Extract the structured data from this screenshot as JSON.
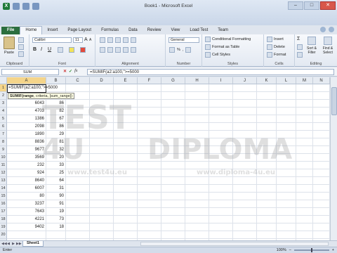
{
  "window": {
    "title": "Book1 - Microsoft Excel",
    "logo_letter": "X",
    "min_glyph": "–",
    "max_glyph": "□",
    "close_glyph": "✕"
  },
  "tabs": [
    {
      "label": "File"
    },
    {
      "label": "Home"
    },
    {
      "label": "Insert"
    },
    {
      "label": "Page Layout"
    },
    {
      "label": "Formulas"
    },
    {
      "label": "Data"
    },
    {
      "label": "Review"
    },
    {
      "label": "View"
    },
    {
      "label": "Load Test"
    },
    {
      "label": "Team"
    }
  ],
  "ribbon": {
    "clipboard": {
      "label": "Clipboard",
      "paste": "Paste"
    },
    "font": {
      "label": "Font",
      "name": "Calibri",
      "size": "11",
      "bold": "B",
      "italic": "I",
      "underline": "U",
      "grow": "A",
      "shrink": "A"
    },
    "alignment": {
      "label": "Alignment"
    },
    "number": {
      "label": "Number",
      "format": "General",
      "percent": "%",
      "comma": ","
    },
    "styles": {
      "label": "Styles",
      "conditional": "Conditional Formatting",
      "format_table": "Format as Table",
      "cell_styles": "Cell Styles"
    },
    "cells": {
      "label": "Cells",
      "insert": "Insert",
      "delete": "Delete",
      "format": "Format"
    },
    "editing": {
      "label": "Editing",
      "sort": "Sort & Filter",
      "find": "Find & Select",
      "sigma": "Σ"
    }
  },
  "formula_bar": {
    "name_box": "SUM",
    "cancel": "✕",
    "enter": "✓",
    "fx": "fx",
    "formula": "=SUMIF(a2:a100,\">=5000"
  },
  "sheet": {
    "columns": [
      "A",
      "B",
      "C",
      "D",
      "E",
      "F",
      "G",
      "H",
      "I",
      "J",
      "K",
      "L",
      "M",
      "N"
    ],
    "row_numbers": [
      "1",
      "2",
      "3",
      "4",
      "5",
      "6",
      "7",
      "8",
      "9",
      "10",
      "11",
      "12",
      "13",
      "14",
      "15",
      "16",
      "17",
      "18",
      "19",
      "20",
      "21"
    ],
    "rows": [
      {
        "a": "",
        "b": ""
      },
      {
        "a": "",
        "b": ""
      },
      {
        "a": "6043",
        "b": "86"
      },
      {
        "a": "4703",
        "b": "82"
      },
      {
        "a": "1386",
        "b": "67"
      },
      {
        "a": "2098",
        "b": "86"
      },
      {
        "a": "1890",
        "b": "29"
      },
      {
        "a": "8836",
        "b": "81"
      },
      {
        "a": "9677",
        "b": "32"
      },
      {
        "a": "3569",
        "b": "20"
      },
      {
        "a": "232",
        "b": "33"
      },
      {
        "a": "924",
        "b": "25"
      },
      {
        "a": "8640",
        "b": "64"
      },
      {
        "a": "6007",
        "b": "31"
      },
      {
        "a": "80",
        "b": "90"
      },
      {
        "a": "3237",
        "b": "91"
      },
      {
        "a": "7643",
        "b": "19"
      },
      {
        "a": "4221",
        "b": "73"
      },
      {
        "a": "9402",
        "b": "18"
      },
      {
        "a": "",
        "b": ""
      },
      {
        "a": "",
        "b": ""
      }
    ],
    "editing_text": "=SUMIF(a2:a100,\">=5000",
    "tooltip": {
      "func": "SUMIF(",
      "arg1": "range",
      "arg2": "criteria",
      "arg3": "[sum_range]",
      "close": ")"
    }
  },
  "watermark": {
    "test": "TEST",
    "four_u": "4U",
    "diploma": "DIPLOMA",
    "url1": "www.test4u.eu",
    "url2": "www.diploma-4u.eu"
  },
  "sheet_tabs": {
    "nav": [
      "◀◀",
      "◀",
      "▶",
      "▶▶"
    ],
    "active": "Sheet1"
  },
  "status": {
    "mode": "Enter",
    "zoom": "100%",
    "minus": "–",
    "plus": "+"
  }
}
